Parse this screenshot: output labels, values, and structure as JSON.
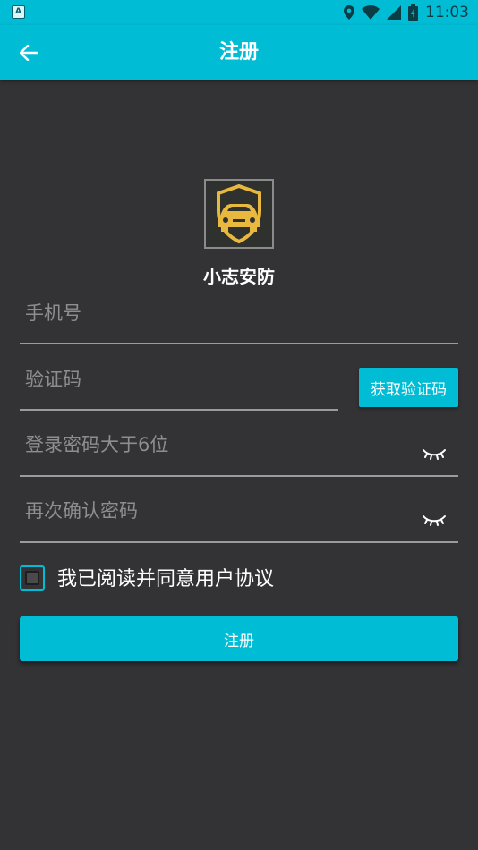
{
  "status_bar": {
    "left_icon_label": "A",
    "time": "11:03",
    "icons": [
      "location-icon",
      "wifi-icon",
      "signal-icon",
      "battery-icon"
    ]
  },
  "toolbar": {
    "title": "注册",
    "back_icon": "arrow-left-icon"
  },
  "app": {
    "name": "小志安防"
  },
  "form": {
    "phone_placeholder": "手机号",
    "code_placeholder": "验证码",
    "get_code_label": "获取验证码",
    "password_placeholder": "登录密码大于6位",
    "confirm_placeholder": "再次确认密码",
    "agree_label": "我已阅读并同意用户协议",
    "agree_checked": false,
    "register_label": "注册"
  },
  "colors": {
    "accent": "#00bcd4",
    "background": "#333235",
    "line": "#9b9a9d",
    "placeholder": "#8e8d90"
  }
}
